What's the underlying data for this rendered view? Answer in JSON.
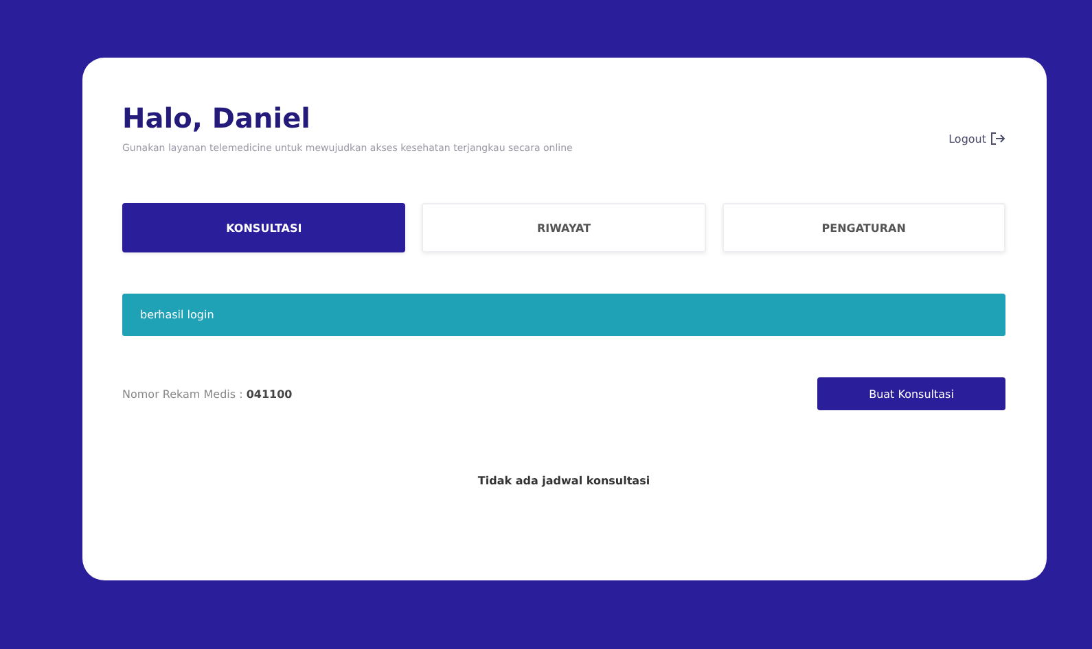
{
  "header": {
    "greeting": "Halo, Daniel",
    "subtitle": "Gunakan layanan telemedicine untuk mewujudkan akses kesehatan terjangkau secara online",
    "logout": "Logout"
  },
  "tabs": [
    {
      "label": "KONSULTASI",
      "selected": true
    },
    {
      "label": "RIWAYAT",
      "selected": false
    },
    {
      "label": "PENGATURAN",
      "selected": false
    }
  ],
  "alert": {
    "message": "berhasil login"
  },
  "record": {
    "text": "Nomor Rekam Medis : **041100**"
  },
  "create_button": "Buat Konsultasi",
  "empty_message": "Tidak ada jadwal konsultasi"
}
